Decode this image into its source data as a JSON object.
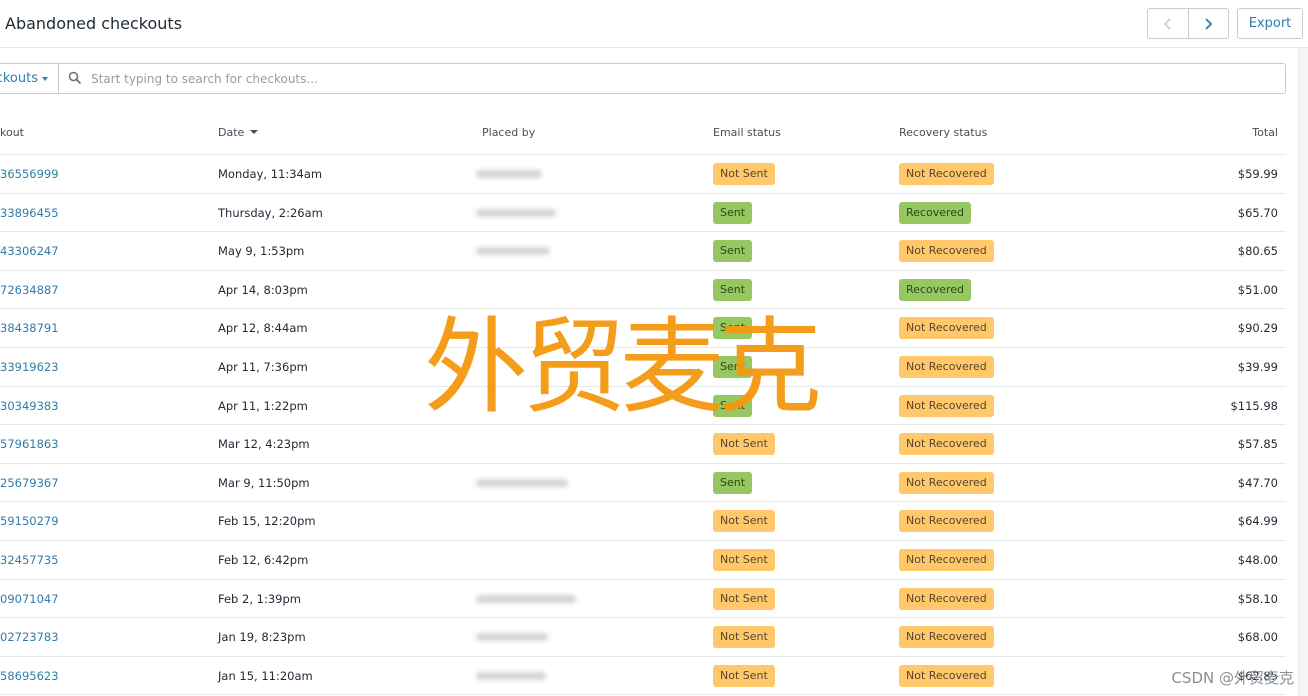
{
  "header": {
    "title": "Abandoned checkouts",
    "prev_icon": "chevron-left-icon",
    "next_icon": "chevron-right-icon",
    "export_label": "Export"
  },
  "filter": {
    "dropdown_label": "ckouts",
    "search_icon": "search-icon",
    "search_placeholder": "Start typing to search for checkouts..."
  },
  "columns": {
    "checkout": "kout",
    "date": "Date",
    "placed_by": "Placed by",
    "email_status": "Email status",
    "recovery_status": "Recovery status",
    "total": "Total"
  },
  "colors": {
    "link": "#2f7ea9",
    "badge_not_sent": "#ffc96b",
    "badge_sent": "#96c760",
    "watermark": "#f49a11"
  },
  "rows": [
    {
      "id": "36556999",
      "date": "Monday, 11:34am",
      "email": "Not Sent",
      "recovery": "Not Recovered",
      "total": "$59.99"
    },
    {
      "id": "33896455",
      "date": "Thursday, 2:26am",
      "email": "Sent",
      "recovery": "Recovered",
      "total": "$65.70"
    },
    {
      "id": "43306247",
      "date": "May 9, 1:53pm",
      "email": "Sent",
      "recovery": "Not Recovered",
      "total": "$80.65"
    },
    {
      "id": "72634887",
      "date": "Apr 14, 8:03pm",
      "email": "Sent",
      "recovery": "Recovered",
      "total": "$51.00"
    },
    {
      "id": "38438791",
      "date": "Apr 12, 8:44am",
      "email": "Sent",
      "recovery": "Not Recovered",
      "total": "$90.29"
    },
    {
      "id": "33919623",
      "date": "Apr 11, 7:36pm",
      "email": "Sent",
      "recovery": "Not Recovered",
      "total": "$39.99"
    },
    {
      "id": "30349383",
      "date": "Apr 11, 1:22pm",
      "email": "Sent",
      "recovery": "Not Recovered",
      "total": "$115.98"
    },
    {
      "id": "57961863",
      "date": "Mar 12, 4:23pm",
      "email": "Not Sent",
      "recovery": "Not Recovered",
      "total": "$57.85"
    },
    {
      "id": "25679367",
      "date": "Mar 9, 11:50pm",
      "email": "Sent",
      "recovery": "Not Recovered",
      "total": "$47.70"
    },
    {
      "id": "59150279",
      "date": "Feb 15, 12:20pm",
      "email": "Not Sent",
      "recovery": "Not Recovered",
      "total": "$64.99"
    },
    {
      "id": "32457735",
      "date": "Feb 12, 6:42pm",
      "email": "Not Sent",
      "recovery": "Not Recovered",
      "total": "$48.00"
    },
    {
      "id": "09071047",
      "date": "Feb 2, 1:39pm",
      "email": "Not Sent",
      "recovery": "Not Recovered",
      "total": "$58.10"
    },
    {
      "id": "02723783",
      "date": "Jan 19, 8:23pm",
      "email": "Not Sent",
      "recovery": "Not Recovered",
      "total": "$68.00"
    },
    {
      "id": "58695623",
      "date": "Jan 15, 11:20am",
      "email": "Not Sent",
      "recovery": "Not Recovered",
      "total": "$62.85"
    }
  ],
  "watermark": "外贸麦克",
  "footer_watermark": "CSDN @外贸麦克"
}
